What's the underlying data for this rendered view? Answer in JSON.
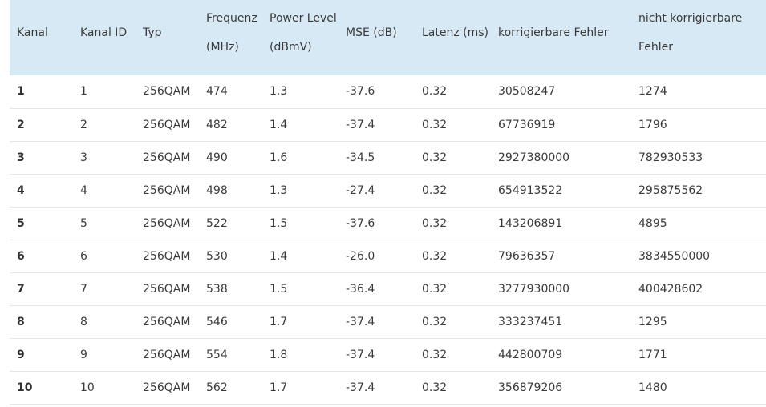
{
  "table": {
    "headers": [
      "Kanal",
      "Kanal ID",
      "Typ",
      "Frequenz (MHz)",
      "Power Level (dBmV)",
      "MSE (dB)",
      "Latenz (ms)",
      "korrigierbare Fehler",
      "nicht korrigierbare Fehler"
    ],
    "rows": [
      [
        "1",
        "1",
        "256QAM",
        "474",
        "1.3",
        "-37.6",
        "0.32",
        "30508247",
        "1274"
      ],
      [
        "2",
        "2",
        "256QAM",
        "482",
        "1.4",
        "-37.4",
        "0.32",
        "67736919",
        "1796"
      ],
      [
        "3",
        "3",
        "256QAM",
        "490",
        "1.6",
        "-34.5",
        "0.32",
        "2927380000",
        "782930533"
      ],
      [
        "4",
        "4",
        "256QAM",
        "498",
        "1.3",
        "-27.4",
        "0.32",
        "654913522",
        "295875562"
      ],
      [
        "5",
        "5",
        "256QAM",
        "522",
        "1.5",
        "-37.6",
        "0.32",
        "143206891",
        "4895"
      ],
      [
        "6",
        "6",
        "256QAM",
        "530",
        "1.4",
        "-26.0",
        "0.32",
        "79636357",
        "3834550000"
      ],
      [
        "7",
        "7",
        "256QAM",
        "538",
        "1.5",
        "-36.4",
        "0.32",
        "3277930000",
        "400428602"
      ],
      [
        "8",
        "8",
        "256QAM",
        "546",
        "1.7",
        "-37.4",
        "0.32",
        "333237451",
        "1295"
      ],
      [
        "9",
        "9",
        "256QAM",
        "554",
        "1.8",
        "-37.4",
        "0.32",
        "442800709",
        "1771"
      ],
      [
        "10",
        "10",
        "256QAM",
        "562",
        "1.7",
        "-37.4",
        "0.32",
        "356879206",
        "1480"
      ]
    ]
  }
}
